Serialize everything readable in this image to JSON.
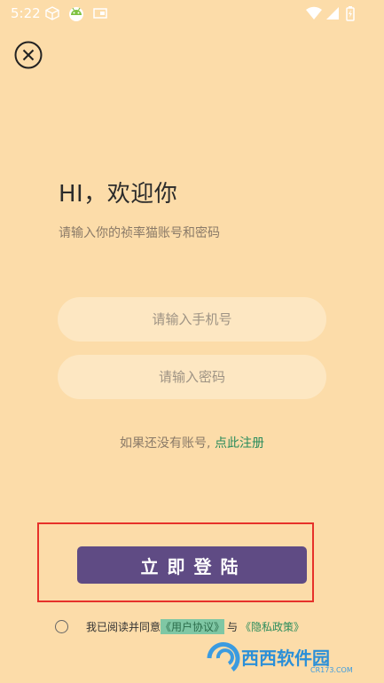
{
  "status_bar": {
    "time": "5:22",
    "icons": [
      "cube-icon",
      "android-app-icon",
      "screen-icon",
      "wifi-icon",
      "signal-icon",
      "battery-icon"
    ]
  },
  "close_icon": "close-circle-icon",
  "greeting": "HI，欢迎你",
  "subtitle": "请输入你的祯率猫账号和密码",
  "phone_field": {
    "placeholder": "请输入手机号",
    "value": ""
  },
  "password_field": {
    "placeholder": "请输入密码",
    "value": ""
  },
  "register": {
    "prompt": "如果还没有账号, ",
    "link": "点此注册"
  },
  "login_button": "立即登陆",
  "agreement": {
    "prefix": "我已阅读并同意",
    "user_agreement": "《用户协议》",
    "conjunction": "与",
    "privacy_policy": "《隐私政策》"
  },
  "watermark": {
    "brand": "西西软件园",
    "domain": "CR173.COM"
  },
  "colors": {
    "background": "#fcdca9",
    "field": "#fde7c2",
    "button": "#5f4b84",
    "link": "#2a8c5c",
    "highlight_border": "#e6312a"
  }
}
